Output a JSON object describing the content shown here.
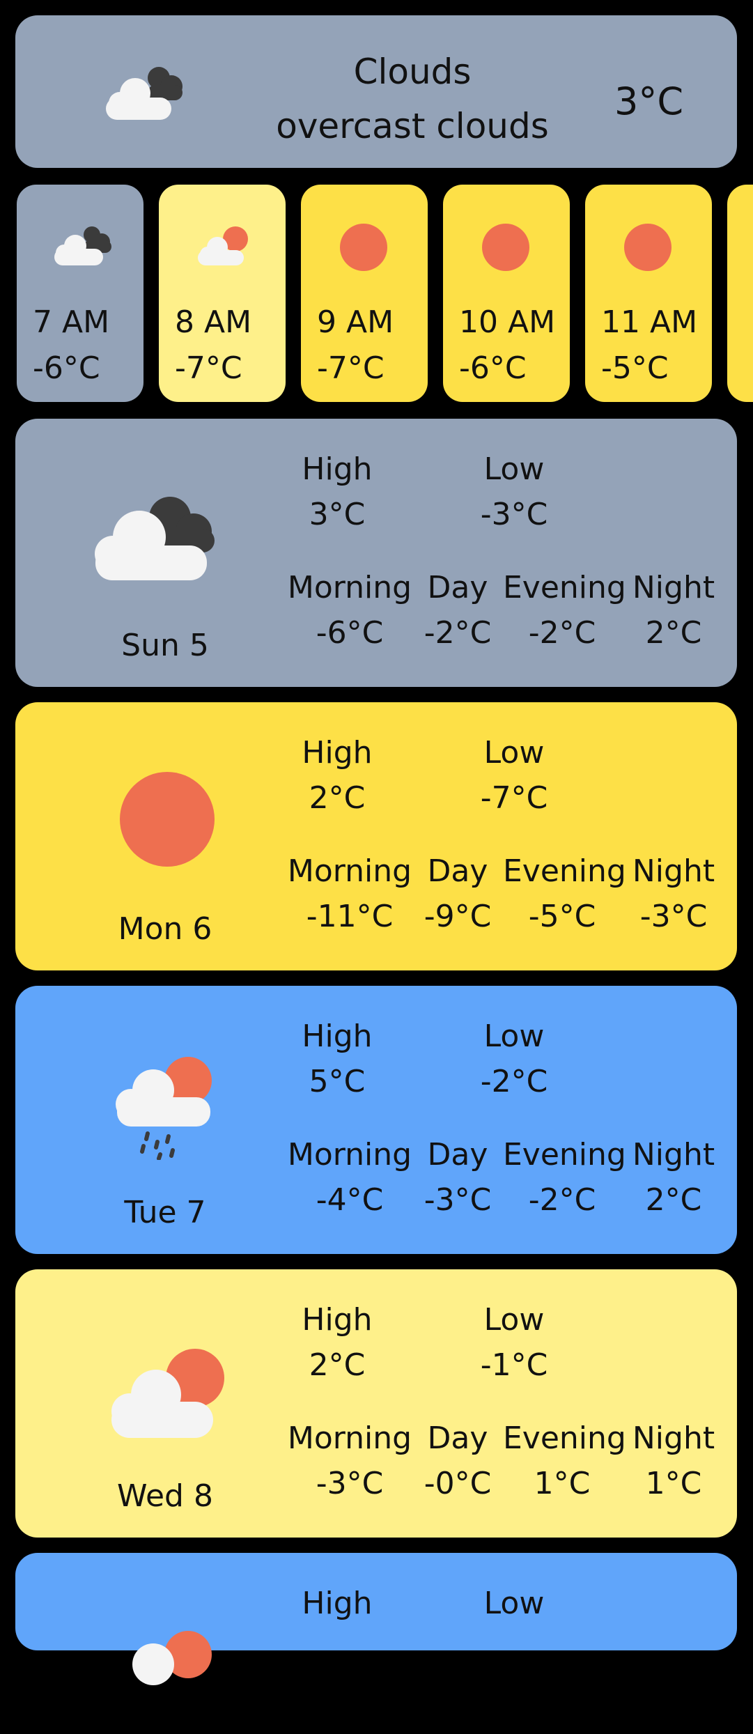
{
  "colors": {
    "cloudy_gray": "#94a3b8",
    "sunny_yellow": "#fde047",
    "pale_yellow": "#fef08a",
    "rain_blue": "#60a5fa",
    "sun": "#ee6f50",
    "cloud": "#f4f4f4",
    "dark_cloud": "#3b3b3b",
    "background": "#000000"
  },
  "current": {
    "icon": "overcast-clouds-icon",
    "condition": "Clouds",
    "description": "overcast clouds",
    "temp": "3°C"
  },
  "hourly": [
    {
      "time": "7 AM",
      "temp": "-6°C",
      "icon": "overcast-clouds-icon"
    },
    {
      "time": "8 AM",
      "temp": "-7°C",
      "icon": "partly-cloudy-icon"
    },
    {
      "time": "9 AM",
      "temp": "-7°C",
      "icon": "sun-icon"
    },
    {
      "time": "10 AM",
      "temp": "-6°C",
      "icon": "sun-icon"
    },
    {
      "time": "11 AM",
      "temp": "-5°C",
      "icon": "sun-icon"
    }
  ],
  "labels": {
    "high": "High",
    "low": "Low",
    "morning": "Morning",
    "day": "Day",
    "evening": "Evening",
    "night": "Night"
  },
  "daily": [
    {
      "day": "Sun 5",
      "icon": "overcast-clouds-icon",
      "high": "3°C",
      "low": "-3°C",
      "morning": "-6°C",
      "daytime": "-2°C",
      "evening": "-2°C",
      "night": "2°C"
    },
    {
      "day": "Mon 6",
      "icon": "sun-icon",
      "high": "2°C",
      "low": "-7°C",
      "morning": "-11°C",
      "daytime": "-9°C",
      "evening": "-5°C",
      "night": "-3°C"
    },
    {
      "day": "Tue 7",
      "icon": "rain-icon",
      "high": "5°C",
      "low": "-2°C",
      "morning": "-4°C",
      "daytime": "-3°C",
      "evening": "-2°C",
      "night": "2°C"
    },
    {
      "day": "Wed 8",
      "icon": "partly-cloudy-icon",
      "high": "2°C",
      "low": "-1°C",
      "morning": "-3°C",
      "daytime": "-0°C",
      "evening": "1°C",
      "night": "1°C"
    },
    {
      "high": "High",
      "low": "Low"
    }
  ]
}
